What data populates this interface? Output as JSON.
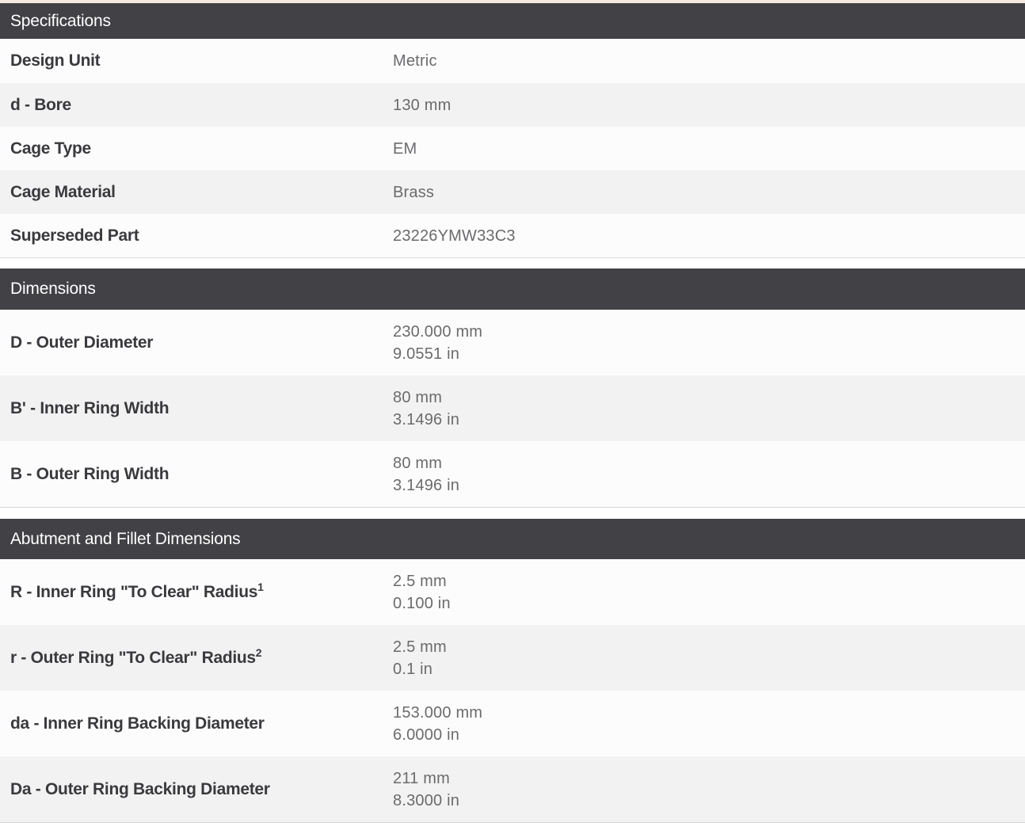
{
  "specifications": {
    "title": "Specifications",
    "rows": [
      {
        "label": "Design Unit",
        "value": "Metric"
      },
      {
        "label": "d - Bore",
        "value": "130 mm"
      },
      {
        "label": "Cage Type",
        "value": "EM"
      },
      {
        "label": "Cage Material",
        "value": "Brass"
      },
      {
        "label": "Superseded Part",
        "value": "23226YMW33C3"
      }
    ]
  },
  "dimensions": {
    "title": "Dimensions",
    "rows": [
      {
        "label": "D - Outer Diameter",
        "metric": "230.000 mm",
        "imperial": "9.0551 in"
      },
      {
        "label": "B' - Inner Ring Width",
        "metric": "80 mm",
        "imperial": "3.1496 in"
      },
      {
        "label": "B - Outer Ring Width",
        "metric": "80 mm",
        "imperial": "3.1496 in"
      }
    ]
  },
  "abutment": {
    "title": "Abutment and Fillet Dimensions",
    "rows": [
      {
        "label": "R - Inner Ring \"To Clear\" Radius",
        "sup": "1",
        "metric": "2.5 mm",
        "imperial": "0.100 in"
      },
      {
        "label": "r - Outer Ring \"To Clear\" Radius",
        "sup": "2",
        "metric": "2.5 mm",
        "imperial": "0.1 in"
      },
      {
        "label": "da - Inner Ring Backing Diameter",
        "metric": "153.000 mm",
        "imperial": "6.0000 in"
      },
      {
        "label": "Da - Outer Ring Backing Diameter",
        "metric": "211 mm",
        "imperial": "8.3000 in"
      }
    ]
  },
  "colors": {
    "header_bg": "#424146",
    "header_text": "#ffffff",
    "row_odd": "#fcfcfc",
    "row_even": "#f2f2f2",
    "label_text": "#3a3a3e",
    "value_text": "#6b6b6e",
    "top_strip": "#f4e9dc"
  }
}
